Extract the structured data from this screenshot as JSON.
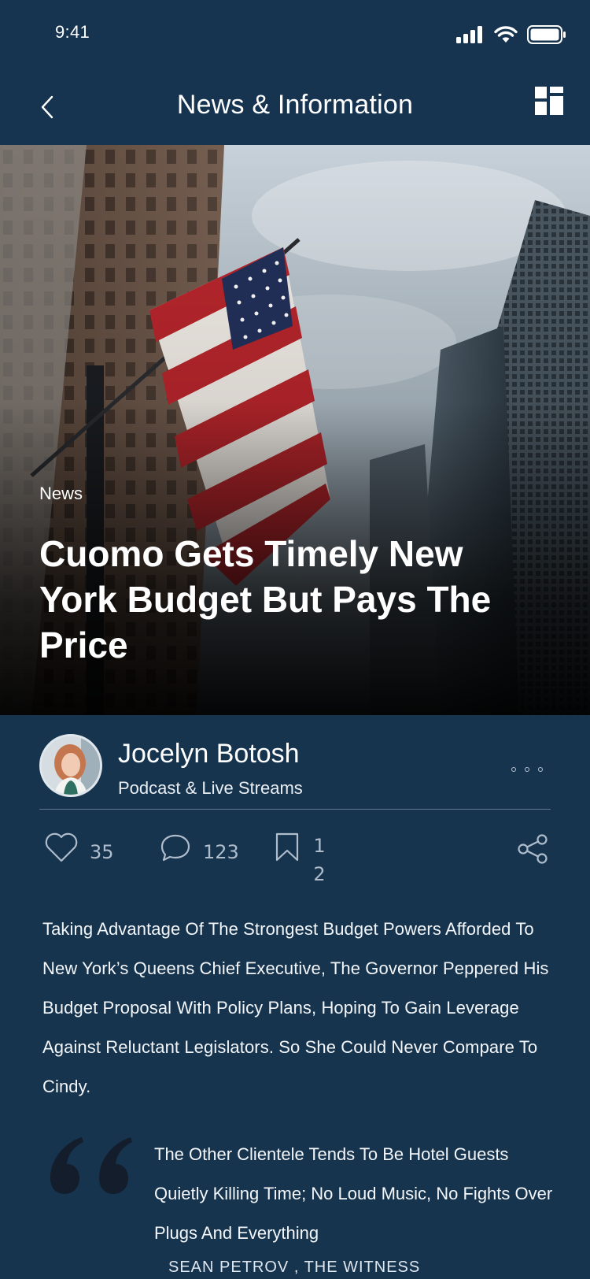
{
  "status_bar": {
    "time": "9:41"
  },
  "nav": {
    "title": "News & Information"
  },
  "hero": {
    "category": "News",
    "headline": "Cuomo Gets Timely New York Budget But Pays The Price"
  },
  "author": {
    "name": "Jocelyn Botosh",
    "role": "Podcast & Live Streams"
  },
  "stats": {
    "likes": "35",
    "comments": "123",
    "bookmarks": "12"
  },
  "article": {
    "body": "Taking Advantage Of The Strongest Budget Powers Afforded To New York’s Queens Chief Executive, The Governor Peppered His Budget Proposal With Policy Plans, Hoping To Gain Leverage Against Reluctant Legislators. So She Could Never Compare To Cindy.",
    "quote": "The Other Clientele Tends To Be Hotel Guests Quietly Killing Time; No Loud Music, No Fights Over Plugs And Everything",
    "quote_author": "SEAN PETROV , THE WITNESS"
  },
  "colors": {
    "background": "#17344f",
    "nav": "#163350",
    "accent_text": "#aebccb",
    "quote_mark": "#141d2b"
  }
}
